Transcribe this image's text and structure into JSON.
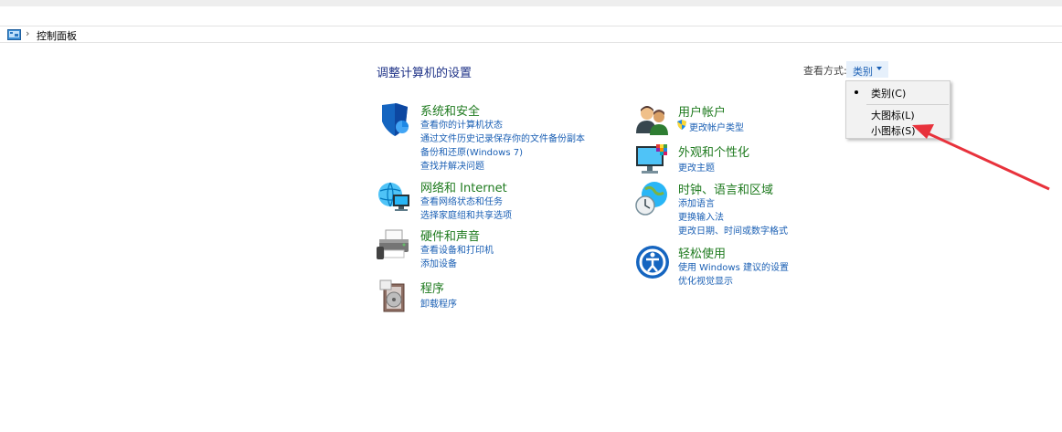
{
  "breadcrumb": {
    "separator": "›",
    "current": "控制面板"
  },
  "header": {
    "title": "调整计算机的设置",
    "view_by_label": "查看方式:",
    "view_by_value": "类别"
  },
  "view_menu": {
    "items": [
      {
        "label": "类别(C)",
        "selected": true
      },
      {
        "label": "大图标(L)",
        "selected": false
      },
      {
        "label": "小图标(S)",
        "selected": false
      }
    ]
  },
  "categories_left": [
    {
      "title": "系统和安全",
      "icon": "shield-icon",
      "links": [
        "查看你的计算机状态",
        "通过文件历史记录保存你的文件备份副本",
        "备份和还原(Windows 7)",
        "查找并解决问题"
      ]
    },
    {
      "title": "网络和 Internet",
      "icon": "network-icon",
      "links": [
        "查看网络状态和任务",
        "选择家庭组和共享选项"
      ]
    },
    {
      "title": "硬件和声音",
      "icon": "printer-icon",
      "links": [
        "查看设备和打印机",
        "添加设备"
      ]
    },
    {
      "title": "程序",
      "icon": "programs-icon",
      "links": [
        "卸载程序"
      ]
    }
  ],
  "categories_right": [
    {
      "title": "用户帐户",
      "icon": "users-icon",
      "links": [
        "更改帐户类型"
      ]
    },
    {
      "title": "外观和个性化",
      "icon": "monitor-palette-icon",
      "links": [
        "更改主题"
      ]
    },
    {
      "title": "时钟、语言和区域",
      "icon": "clock-globe-icon",
      "links": [
        "添加语言",
        "更换输入法",
        "更改日期、时间或数字格式"
      ]
    },
    {
      "title": "轻松使用",
      "icon": "ease-of-access-icon",
      "links": [
        "使用 Windows 建议的设置",
        "优化视觉显示"
      ]
    }
  ],
  "colors": {
    "title": "#1e3287",
    "category": "#1e7a1e",
    "link": "#1a5fb4",
    "annotation_arrow": "#e8323c"
  }
}
